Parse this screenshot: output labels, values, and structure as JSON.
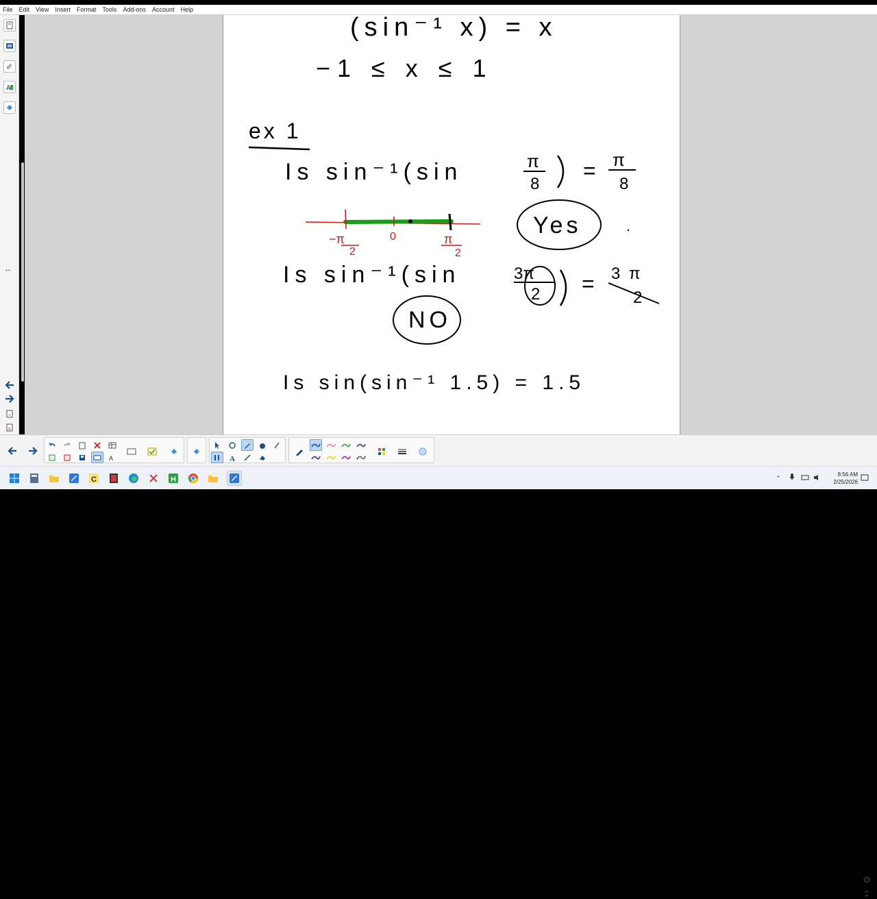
{
  "menu": [
    "File",
    "Edit",
    "View",
    "Insert",
    "Format",
    "Tools",
    "Add-ons",
    "Account",
    "Help"
  ],
  "left_tools": [
    "page-sorter-icon",
    "gallery-icon",
    "attachments-icon",
    "properties-icon",
    "add-ons-icon"
  ],
  "notes": {
    "line1": "(sin⁻¹ x) = x",
    "line2": "−1 ≤ x ≤ 1",
    "ex_label": "ex 1",
    "q1_left": "Is sin⁻¹(sin",
    "q1_frac_num": "π",
    "q1_frac_den": "8",
    "q1_eq": "=",
    "q1_answer": "Yes",
    "numline_left": "−π",
    "numline_left_den": "2",
    "numline_zero": "0",
    "numline_right": "π",
    "numline_right_den": "2",
    "q2_left": "Is sin⁻¹(sin",
    "q2_frac_num": "3π",
    "q2_frac_den": "2",
    "q2_eq": "=",
    "q2_rhs_num": "3 π",
    "q2_rhs_den": "2",
    "q2_answer": "NO",
    "q3": "Is sin(sin⁻¹ 1.5) = 1.5"
  },
  "clock": {
    "time": "8:56 AM",
    "date": "2/25/2026"
  },
  "colors": {
    "ink": "#000000",
    "green": "#1a9e1a",
    "red": "#d11a1a",
    "accent": "#2b7bd4"
  }
}
